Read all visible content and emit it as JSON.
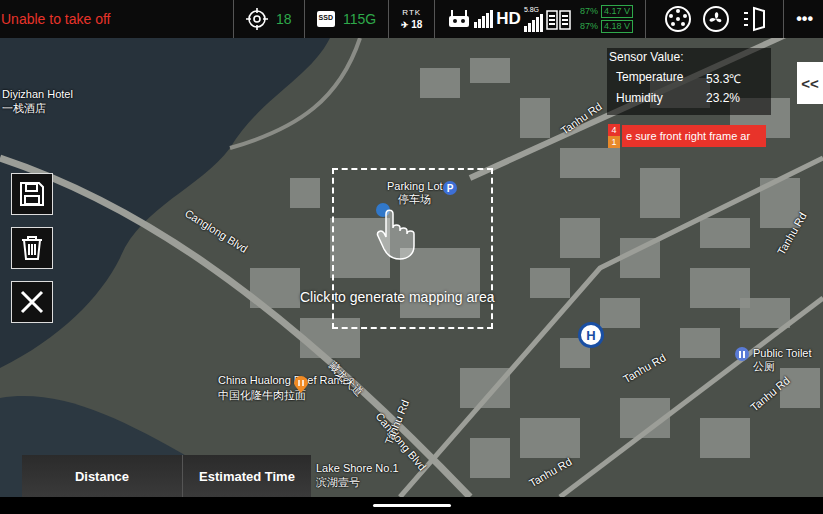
{
  "status": {
    "text": "Unable to take off",
    "color": "#e8332a"
  },
  "top_stats": [
    {
      "kind": "target",
      "label": "",
      "value": "18",
      "color": "#2ea84a"
    },
    {
      "kind": "ssd",
      "label": "SSD",
      "value": "115G",
      "color": "#2ea84a"
    },
    {
      "kind": "rtk",
      "label": "RTK",
      "value": "18",
      "color": "#ffffff"
    }
  ],
  "link": {
    "label": "HD",
    "band": "5.8G",
    "signals": [
      {
        "level": 1
      },
      {
        "level": 1
      }
    ]
  },
  "batteries": [
    {
      "percent": "87%",
      "voltage": "4.17 V"
    },
    {
      "percent": "87%",
      "voltage": "4.18 V"
    }
  ],
  "more": "•••",
  "sensor": {
    "title": "Sensor Value:",
    "rows": [
      {
        "label": "Temperature",
        "value": "53.3℃"
      },
      {
        "label": "Humidity",
        "value": "23.2%"
      }
    ]
  },
  "alerts": {
    "counts": [
      {
        "value": "4",
        "color": "#e8332a"
      },
      {
        "value": "1",
        "color": "#e8892a"
      }
    ],
    "message": "e sure front right frame ar"
  },
  "collapse": "<<",
  "mapping": {
    "hint": "Click to generate mapping area"
  },
  "home": "H",
  "parking_pin": "P",
  "map_labels": [
    {
      "text": "Diyizhan Hotel"
    },
    {
      "text": "一栈酒店"
    },
    {
      "text": "Canglong Blvd"
    },
    {
      "text": "Parking Lot"
    },
    {
      "text": "停车场"
    },
    {
      "text": "Tanhu Rd"
    },
    {
      "text": "China Hualong Beef Ramen"
    },
    {
      "text": "中国化隆牛肉拉面"
    },
    {
      "text": "Canglong Blvd"
    },
    {
      "text": "Tanhu Rd"
    },
    {
      "text": "Lake Shore No.1"
    },
    {
      "text": "滨湖壹号"
    },
    {
      "text": "Public Toilet"
    },
    {
      "text": "公厕"
    },
    {
      "text": "Tanhu Rd"
    },
    {
      "text": "Tanhu Rd"
    },
    {
      "text": "Tanhu Rd"
    },
    {
      "text": "Tanhu Rd"
    },
    {
      "text": "藏龙大道"
    }
  ],
  "bottom_panel": [
    {
      "label": "Distance"
    },
    {
      "label": "Estimated Time"
    }
  ]
}
